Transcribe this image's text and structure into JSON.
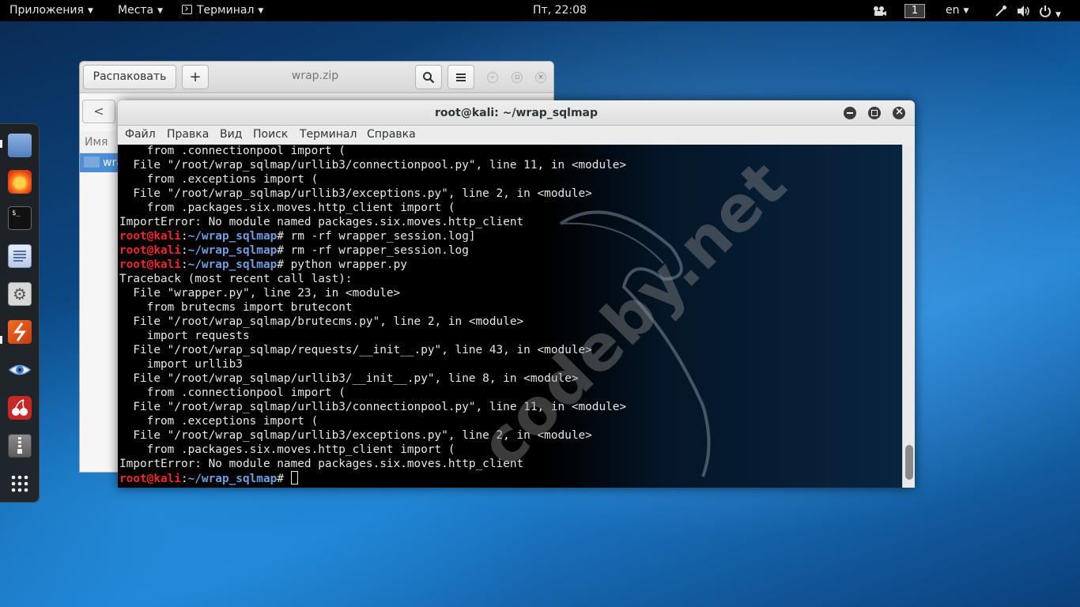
{
  "topbar": {
    "apps_menu": "Приложения",
    "places_menu": "Места",
    "terminal_menu": "Терминал",
    "clock": "Пт, 22:08",
    "workspace": "1",
    "language": "en"
  },
  "dock": {
    "items": [
      "files-icon",
      "firefox-icon",
      "terminal-icon",
      "text-editor-icon",
      "settings-icon",
      "burpsuite-icon",
      "eye-icon",
      "cherry-icon",
      "archive-icon",
      "show-apps-icon"
    ]
  },
  "file_roller": {
    "extract_label": "Распаковать",
    "add_label": "+",
    "title": "wrap.zip",
    "back_label": "<",
    "column_name": "Имя",
    "row_name": "wrap"
  },
  "terminal": {
    "title": "root@kali: ~/wrap_sqlmap",
    "menu": [
      "Файл",
      "Правка",
      "Вид",
      "Поиск",
      "Терминал",
      "Справка"
    ],
    "prompt_user": "root@kali",
    "prompt_path": "~/wrap_sqlmap",
    "lines": [
      {
        "text": "    from .connectionpool import ("
      },
      {
        "text": "  File \"/root/wrap_sqlmap/urllib3/connectionpool.py\", line 11, in <module>"
      },
      {
        "text": "    from .exceptions import ("
      },
      {
        "text": "  File \"/root/wrap_sqlmap/urllib3/exceptions.py\", line 2, in <module>"
      },
      {
        "text": "    from .packages.six.moves.http_client import ("
      },
      {
        "text": "ImportError: No module named packages.six.moves.http_client"
      },
      {
        "cmd": "rm -rf wrapper_session.log]"
      },
      {
        "cmd": "rm -rf wrapper_session.log"
      },
      {
        "cmd": "python wrapper.py"
      },
      {
        "text": "Traceback (most recent call last):"
      },
      {
        "text": "  File \"wrapper.py\", line 23, in <module>"
      },
      {
        "text": "    from brutecms import brutecont"
      },
      {
        "text": "  File \"/root/wrap_sqlmap/brutecms.py\", line 2, in <module>"
      },
      {
        "text": "    import requests"
      },
      {
        "text": "  File \"/root/wrap_sqlmap/requests/__init__.py\", line 43, in <module>"
      },
      {
        "text": "    import urllib3"
      },
      {
        "text": "  File \"/root/wrap_sqlmap/urllib3/__init__.py\", line 8, in <module>"
      },
      {
        "text": "    from .connectionpool import ("
      },
      {
        "text": "  File \"/root/wrap_sqlmap/urllib3/connectionpool.py\", line 11, in <module>"
      },
      {
        "text": "    from .exceptions import ("
      },
      {
        "text": "  File \"/root/wrap_sqlmap/urllib3/exceptions.py\", line 2, in <module>"
      },
      {
        "text": "    from .packages.six.moves.http_client import ("
      },
      {
        "text": "ImportError: No module named packages.six.moves.http_client"
      },
      {
        "cmd": ""
      }
    ]
  },
  "watermark": "codeby.net"
}
